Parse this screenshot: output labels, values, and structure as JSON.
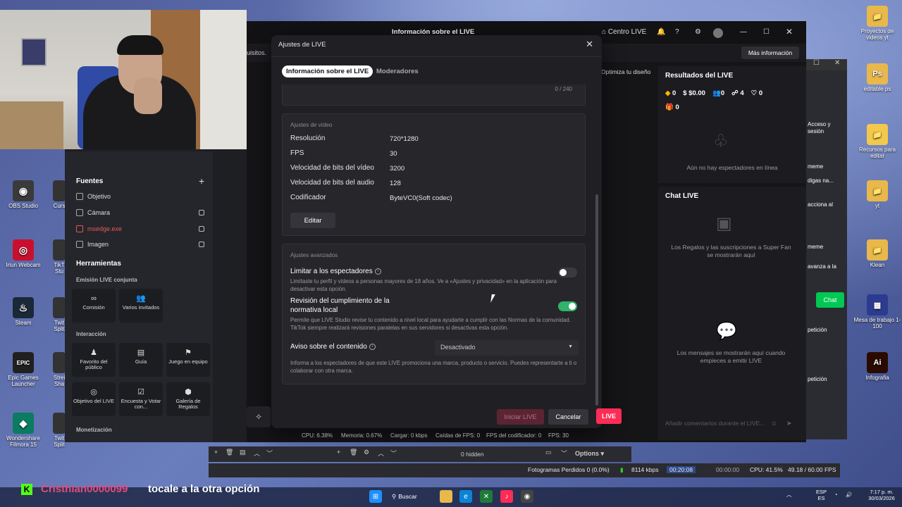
{
  "desktop": {
    "icons_left": [
      {
        "label": "OBS Studio",
        "glyph": "◉",
        "color": "#3a3a3a"
      },
      {
        "label": "Iriun Webcam",
        "glyph": "◎",
        "color": "#c8102e"
      },
      {
        "label": "Steam",
        "glyph": "♨",
        "color": "#1b2838"
      },
      {
        "label": "Epic Games Launcher",
        "glyph": "EPIC",
        "color": "#202020"
      },
      {
        "label": "Wondershare Filmora 15",
        "glyph": "◆",
        "color": "#0b7b61"
      }
    ],
    "icons_left_partial": [
      "Curs",
      "TikT Stu",
      "Twit Split",
      "Strei Sha",
      "Twit Split"
    ],
    "icons_right": [
      {
        "label": "Proyectos de videos yt",
        "glyph": "📁",
        "color": "#e8b84a"
      },
      {
        "label": "editable ps",
        "glyph": "Ps",
        "color": "#e8b84a"
      },
      {
        "label": "Recursos para editar",
        "glyph": "📁",
        "color": "#f2c94c"
      },
      {
        "label": "yt",
        "glyph": "📁",
        "color": "#e8b84a"
      },
      {
        "label": "Klean",
        "glyph": "📁",
        "color": "#e8b84a"
      },
      {
        "label": "Mesa de trabajo 1-100",
        "glyph": "▦",
        "color": "#2b3b8f"
      },
      {
        "label": "Infografia",
        "glyph": "Ai",
        "color": "#2a0a00"
      }
    ]
  },
  "obs": {
    "sources_title": "Fuentes",
    "sources": [
      {
        "label": "Objetivo",
        "color": "#dddddd"
      },
      {
        "label": "Cámara",
        "color": "#dddddd"
      },
      {
        "label": "msedge.exe",
        "color": "#e05a5a"
      },
      {
        "label": "Imagen",
        "color": "#dddddd"
      }
    ],
    "tools_title": "Herramientas",
    "section_live_conjunta": "Emisión LIVE conjunta",
    "tiles_row1": [
      "Comisión",
      "Varios invitados"
    ],
    "section_interaccion": "Interacción",
    "tiles_row2": [
      "Favorito del público",
      "Guía",
      "Juego en equipo"
    ],
    "tiles_row3": [
      "Objetivo del LIVE",
      "Encuesta y Votar con...",
      "Galería de Regalos"
    ],
    "section_monetizacion": "Monetización",
    "stats": {
      "cpu": "CPU: 6.38%",
      "memoria": "Memoria: 0.67%",
      "cargar": "Cargar: 0 kbps",
      "caidas": "Caídas de FPS: 0",
      "fps_codificador": "FPS del codificador: 0",
      "fps": "FPS: 30"
    },
    "hidden_label": "0 hidden",
    "options_label": "Options",
    "status": {
      "dropped": "Fotogramas Perdidos 0 (0.0%)",
      "kbps": "8114 kbps",
      "time": "00:20:08",
      "rec_time": "00:00:00",
      "cpu": "CPU: 41.5%",
      "fps": "49.18 / 60.00 FPS"
    }
  },
  "tiktok": {
    "window_title": "Información sobre el LIVE",
    "centro_live": "Centro LIVE",
    "partial_left_text": "uisitos.",
    "mas_info": "Más información",
    "optimiza": "Optimiza tu diseño",
    "resultados_title": "Resultados del LIVE",
    "stats": [
      "0",
      "$0.00",
      "0",
      "4",
      "0",
      "0"
    ],
    "no_viewers": "Aún no hay espectadores en línea",
    "chat_title": "Chat LIVE",
    "gifts_msg": "Los Regalos y las suscripciones a Super Fan se mostrarán aquí",
    "messages_msg": "Los mensajes se mostrarán aquí cuando empieces a emitir LIVE",
    "comment_placeholder": "Añadir comentarios durante el LIVE...",
    "live_button": "LIVE",
    "chat_button": "Chat"
  },
  "side_strip": [
    "Acceso y sesión",
    "meme",
    "digas na...",
    "acciona al",
    "meme",
    "avanza a la",
    "petición",
    "petición"
  ],
  "modal": {
    "title": "Ajustes de LIVE",
    "tabs": [
      "Información sobre el LIVE",
      "Moderadores"
    ],
    "char_count": "0 / 240",
    "video_section": "Ajustes de vídeo",
    "video_settings": [
      {
        "label": "Resolución",
        "value": "720*1280"
      },
      {
        "label": "FPS",
        "value": "30"
      },
      {
        "label": "Velocidad de bits del vídeo",
        "value": "3200"
      },
      {
        "label": "Velocidad de bits del audio",
        "value": "128"
      },
      {
        "label": "Codificador",
        "value": "ByteVC0(Soft codec)"
      }
    ],
    "edit_button": "Editar",
    "advanced_section": "Ajustes avanzados",
    "limit_label": "Limitar a los espectadores",
    "limit_desc": "Limítaste tu perfil y vídeos a personas mayores de 18 años. Ve a «Ajustes y privacidad» en la aplicación para desactivar esta opción.",
    "limit_enabled": false,
    "compliance_label": "Revisión del cumplimiento de la normativa local",
    "compliance_desc": "Permite que LIVE Studio revise tu contenido a nivel local para ayudarte a cumplir con las Normas de la comunidad. TikTok siempre realizará revisiones paralelas en sus servidores si desactivas esta opción.",
    "compliance_enabled": true,
    "content_notice_label": "Aviso sobre el contenido",
    "content_notice_value": "Desactivado",
    "content_notice_desc": "Informa a los espectadores de que este LIVE promociona una marca, producto o servicio. Puedes representarte a ti o colaborar con otra marca.",
    "start_button": "Iniciar LIVE",
    "cancel_button": "Cancelar"
  },
  "chat_overlay": {
    "platform_icon": "K",
    "username": "Cristhian0000099",
    "message": "tocale a la otra opción"
  },
  "taskbar": {
    "search": "Buscar",
    "lang_top": "ESP",
    "lang_bottom": "ES",
    "time": "7:17 p. m.",
    "date": "30/03/2026"
  }
}
